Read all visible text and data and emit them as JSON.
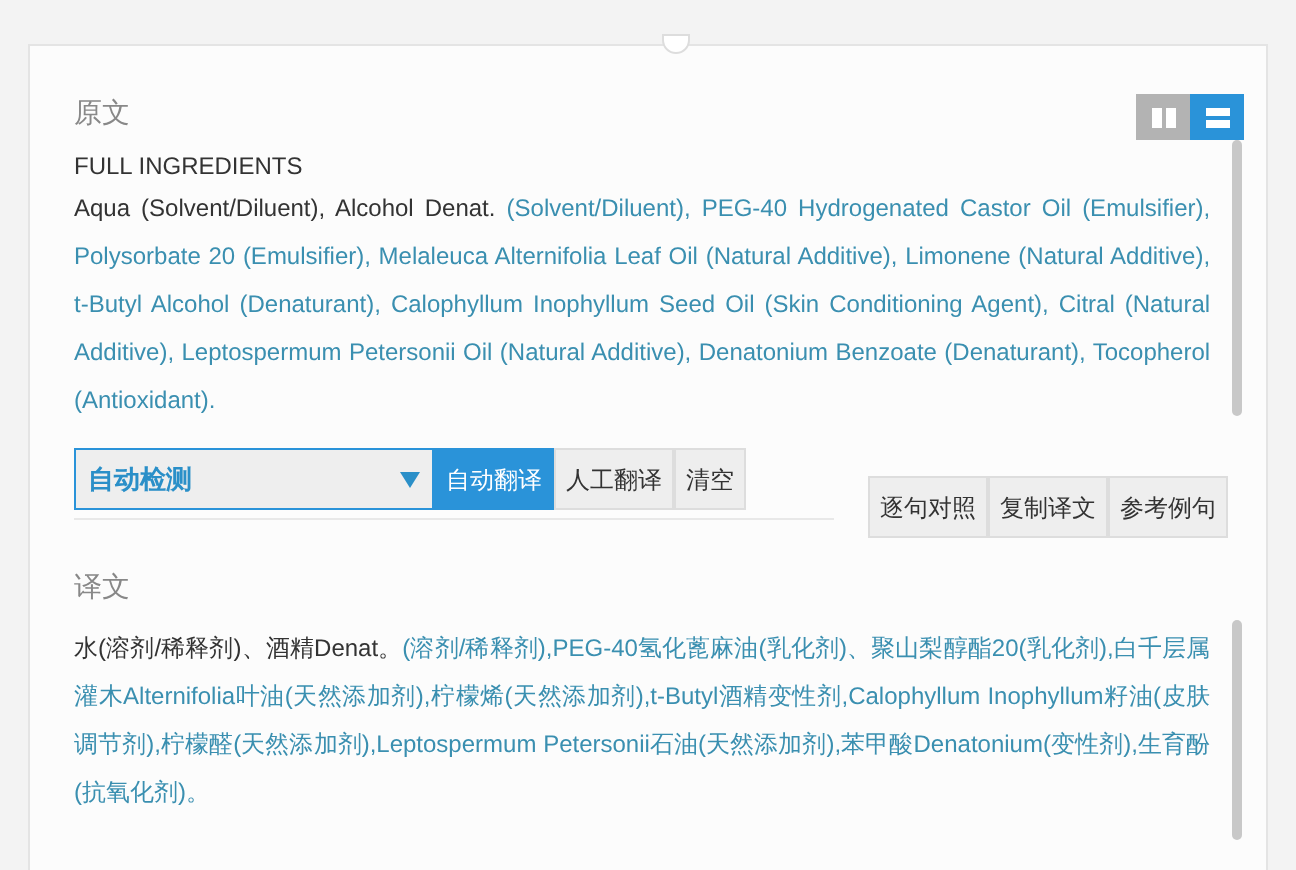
{
  "source": {
    "title": "原文",
    "view_modes": [
      {
        "kind": "columns",
        "selected": false
      },
      {
        "kind": "rows",
        "selected": true
      }
    ],
    "heading": "FULL INGREDIENTS",
    "text": [
      {
        "s": "Aqua (Solvent/Diluent), Alcohol Denat. ",
        "highlighted": false
      },
      {
        "s": "(Solvent/Diluent), PEG-40 Hydrogenated Castor Oil (Emulsifier), Polysorbate 20 (Emulsifier), Melaleuca Alternifolia Leaf Oil (Natural Additive), Limonene (Natural Additive), t-Butyl Alcohol (Denaturant), Calophyllum Inophyllum Seed Oil (Skin Conditioning Agent), Citral (Natural Additive), Leptospermum Petersonii Oil (Natural Additive), Denatonium Benzoate (Denaturant), Tocopherol (Antioxidant).",
        "highlighted": true
      }
    ]
  },
  "toolbar": {
    "language": "自动检测",
    "buttons": [
      {
        "label": "自动翻译",
        "selected": true
      },
      {
        "label": "人工翻译",
        "selected": false
      },
      {
        "label": "清空",
        "selected": false
      }
    ],
    "tools": [
      "逐句对照",
      "复制译文",
      "参考例句"
    ]
  },
  "target": {
    "title": "译文",
    "text": [
      {
        "s": "水(溶剂/稀释剂)、酒精Denat。",
        "highlighted": false
      },
      {
        "s": "(溶剂/稀释剂),PEG-40氢化蓖麻油(乳化剂)、聚山梨醇酯20(乳化剂),白千层属灌木Alternifolia叶油(天然添加剂),柠檬烯(天然添加剂),t-Butyl酒精变性剂,Calophyllum Inophyllum籽油(皮肤调节剂),柠檬醛(天然添加剂),Leptospermum Petersonii石油(天然添加剂),苯甲酸Denatonium(变性剂),生育酚(抗氧化剂)。",
        "highlighted": true
      }
    ]
  }
}
